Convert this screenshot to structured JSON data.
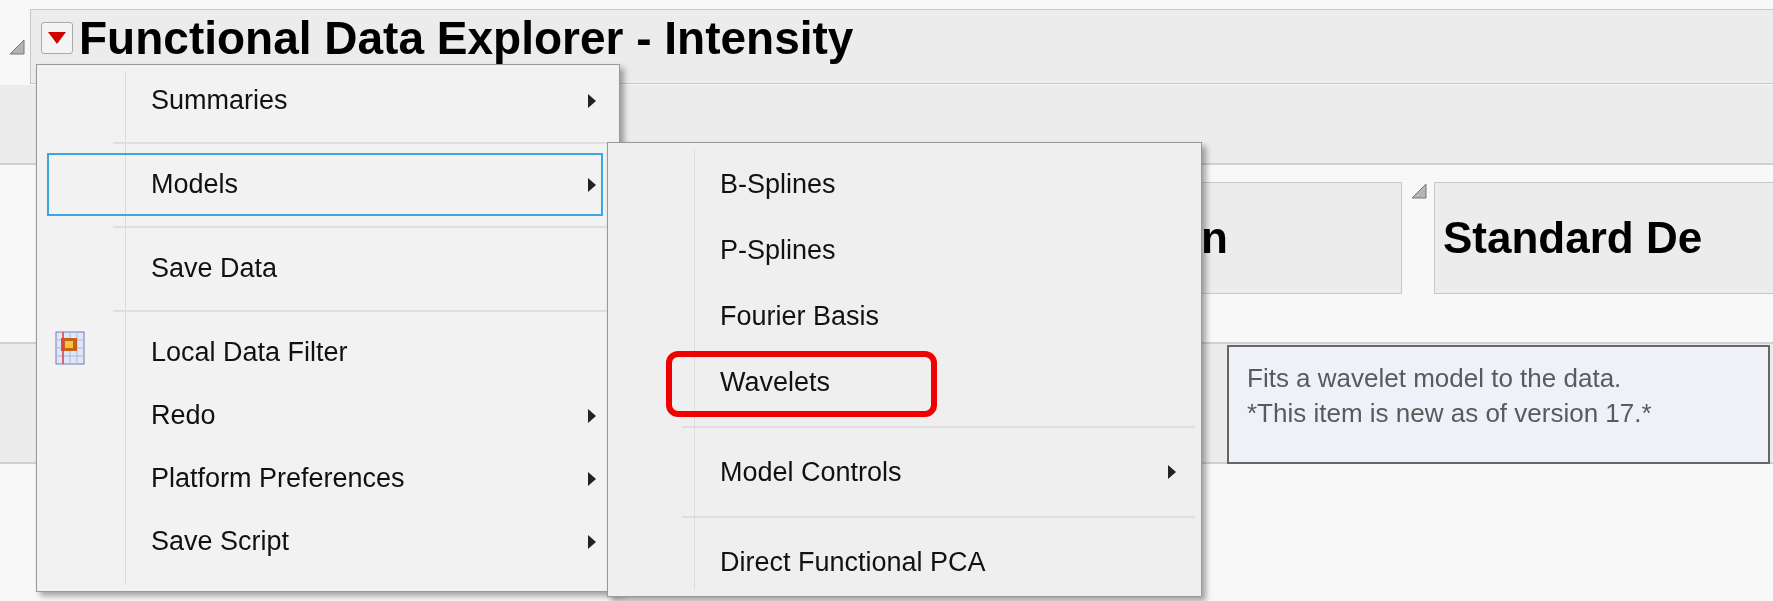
{
  "window": {
    "title": "Functional Data Explorer - Intensity"
  },
  "report_headers": [
    {
      "text": "n",
      "disclosure": false
    },
    {
      "text": "Standard De",
      "disclosure": true
    }
  ],
  "menu": {
    "items": [
      {
        "kind": "item",
        "label": "Summaries",
        "submenu": true,
        "selected": false,
        "icon": false
      },
      {
        "kind": "separator"
      },
      {
        "kind": "item",
        "label": "Models",
        "submenu": true,
        "selected": true,
        "icon": false
      },
      {
        "kind": "separator"
      },
      {
        "kind": "item",
        "label": "Save Data",
        "submenu": false,
        "selected": false,
        "icon": false
      },
      {
        "kind": "separator"
      },
      {
        "kind": "item",
        "label": "Local Data Filter",
        "submenu": false,
        "selected": false,
        "icon": true
      },
      {
        "kind": "item",
        "label": "Redo",
        "submenu": true,
        "selected": false,
        "icon": false
      },
      {
        "kind": "item",
        "label": "Platform Preferences",
        "submenu": true,
        "selected": false,
        "icon": false
      },
      {
        "kind": "item",
        "label": "Save Script",
        "submenu": true,
        "selected": false,
        "icon": false
      }
    ]
  },
  "submenu": {
    "items": [
      {
        "kind": "item",
        "label": "B-Splines",
        "submenu": false,
        "outlined": false
      },
      {
        "kind": "item",
        "label": "P-Splines",
        "submenu": false,
        "outlined": false
      },
      {
        "kind": "item",
        "label": "Fourier Basis",
        "submenu": false,
        "outlined": false
      },
      {
        "kind": "item",
        "label": "Wavelets",
        "submenu": false,
        "outlined": true
      },
      {
        "kind": "separator"
      },
      {
        "kind": "item",
        "label": "Model Controls",
        "submenu": true,
        "outlined": false
      },
      {
        "kind": "separator"
      },
      {
        "kind": "item",
        "label": "Direct Functional PCA",
        "submenu": false,
        "outlined": false
      }
    ]
  },
  "tooltip": {
    "lines": [
      "Fits a wavelet model to the data.",
      "*This item is new as of version 17.*"
    ]
  }
}
